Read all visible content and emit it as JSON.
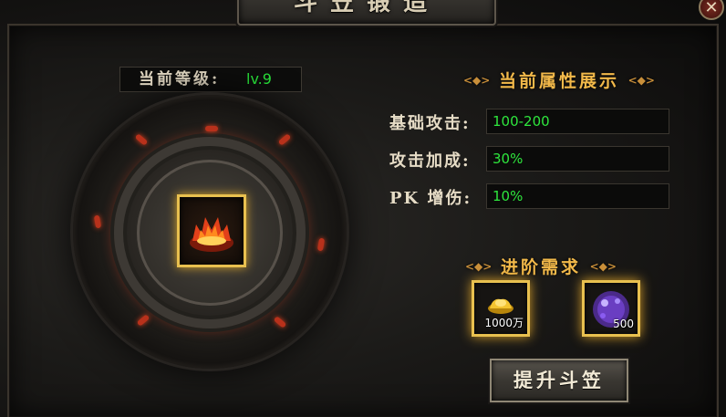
{
  "window": {
    "title": "斗笠锻造",
    "close_icon": "close-icon"
  },
  "level": {
    "label": "当前等级:",
    "value": "lv.9"
  },
  "attributes": {
    "title": "当前属性展示",
    "rows": [
      {
        "label": "基础攻击:",
        "value": "100-200"
      },
      {
        "label": "攻击加成:",
        "value": "30%"
      },
      {
        "label": "PK 增伤:",
        "value": "10%"
      }
    ]
  },
  "requirements": {
    "title": "进阶需求",
    "items": [
      {
        "icon": "gold-ingots-icon",
        "count": "1000万"
      },
      {
        "icon": "purple-gem-orb-icon",
        "count": "500"
      }
    ]
  },
  "item": {
    "icon": "flame-crown-icon"
  },
  "upgrade_button": {
    "label": "提升斗笠"
  },
  "colors": {
    "value_green": "#2ee63d",
    "section_gold": "#f2b94a",
    "slot_border": "#e8c04f"
  }
}
